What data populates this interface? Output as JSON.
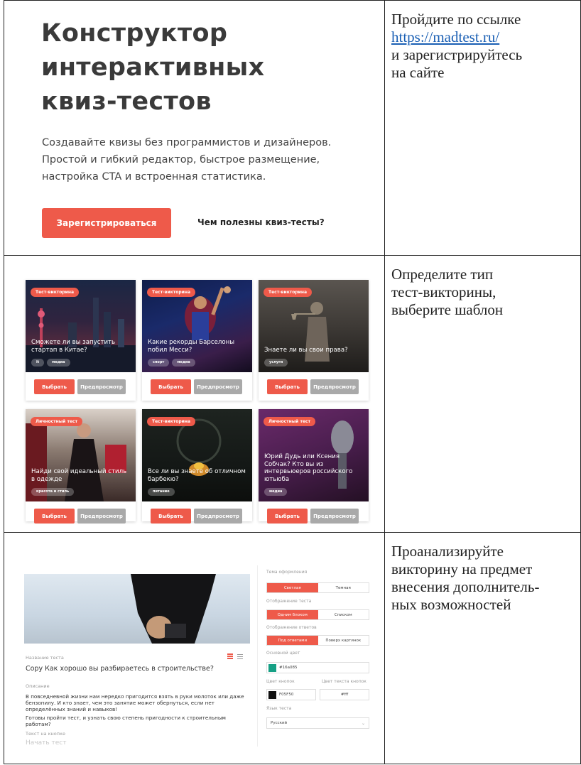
{
  "rows": [
    {
      "instruction": {
        "lines_before_link": [
          "Пройдите по ссылке"
        ],
        "link": "https://madtest.ru/",
        "lines_after_link": [
          "и зарегистрируйтесь",
          "на сайте"
        ]
      },
      "landing": {
        "title_lines": [
          "Конструктор",
          "интерактивных",
          "квиз-тестов"
        ],
        "description_lines": [
          "Создавайте квизы без программистов и дизайнеров.",
          "Простой и гибкий редактор, быстрое размещение,",
          "настройка CTA и встроенная статистика."
        ],
        "register_button": "Зарегистрироваться",
        "why_link": "Чем полезны квиз-тесты?"
      }
    },
    {
      "instruction": {
        "lines": [
          "Определите тип",
          "тест-викторины,",
          "выберите шаблон"
        ]
      },
      "cards": [
        {
          "tag": "Тест-викторина",
          "title": "Сможете ли вы запустить стартап в Китае?",
          "chips": [
            "it",
            "медиа"
          ],
          "choose": "Выбрать",
          "preview": "Предпросмотр"
        },
        {
          "tag": "Тест-викторина",
          "title": "Какие рекорды Барселоны побил Месси?",
          "chips": [
            "спорт",
            "медиа"
          ],
          "choose": "Выбрать",
          "preview": "Предпросмотр"
        },
        {
          "tag": "Тест-викторина",
          "title": "Знаете ли вы свои права?",
          "chips": [
            "услуги"
          ],
          "choose": "Выбрать",
          "preview": "Предпросмотр"
        },
        {
          "tag": "Личностный тест",
          "title": "Найди свой идеальный стиль в одежде",
          "chips": [
            "красота и стиль"
          ],
          "choose": "Выбрать",
          "preview": "Предпросмотр"
        },
        {
          "tag": "Тест-викторина",
          "title": "Все ли вы знаете об отличном барбекю?",
          "chips": [
            "питание"
          ],
          "choose": "Выбрать",
          "preview": "Предпросмотр"
        },
        {
          "tag": "Личностный тест",
          "title": "Юрий Дудь или Ксения Собчак? Кто вы из интервьюеров российского ютьюба",
          "chips": [
            "медиа"
          ],
          "choose": "Выбрать",
          "preview": "Предпросмотр"
        }
      ]
    },
    {
      "instruction": {
        "lines": [
          "Проанализируйте",
          "викторину на предмет",
          "внесения дополнитель-",
          "ных возможностей"
        ]
      },
      "editor": {
        "test_name_label": "Название теста",
        "test_name_value": "Copy Как хорошо вы разбираетесь в строительстве?",
        "description_label": "Описание",
        "description_p1": "В повседневной жизни нам нередко пригодится взять в руки молоток или даже бензопилу. И кто знает, чем это занятие может обернуться, если нет определённых знаний и навыков!",
        "description_p2": "Готовы пройти тест, и узнать свою степень пригодности к строительным работам?",
        "button_text_label": "Текст на кнопке",
        "button_text_value": "Начать тест",
        "settings": {
          "theme_label": "Тема оформления",
          "theme_light": "Светлая",
          "theme_dark": "Темная",
          "display_label": "Отображение теста",
          "display_one": "Одним блоком",
          "display_list": "Списком",
          "answers_label": "Отображение ответов",
          "answers_under": "Под ответами",
          "answers_over": "Поверх картинок",
          "main_color_label": "Основной цвет",
          "main_color_value": "#16a085",
          "btn_color_label": "Цвет кнопок",
          "btn_color_value": "F05F50",
          "btn_text_color_label": "Цвет текста кнопок",
          "btn_text_color_value": "#fff",
          "lang_label": "Язык теста",
          "lang_value": "Русский"
        }
      }
    }
  ],
  "colors": {
    "accent": "#ee5a4a",
    "link": "#1a5fb4",
    "preview_button": "#a9a9a9",
    "main_swatch": "#16a085",
    "button_swatch": "#111111"
  }
}
